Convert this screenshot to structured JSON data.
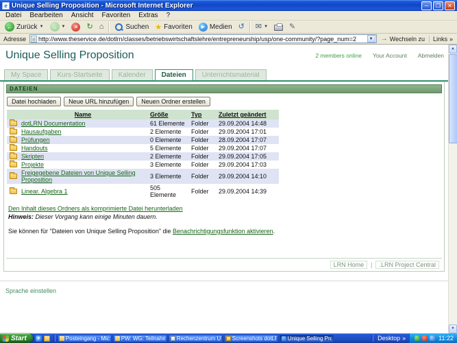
{
  "window": {
    "title": "Unique Selling Proposition - Microsoft Internet Explorer"
  },
  "menu": {
    "items": [
      "Datei",
      "Bearbeiten",
      "Ansicht",
      "Favoriten",
      "Extras",
      "?"
    ]
  },
  "toolbar": {
    "back": "Zurück",
    "search": "Suchen",
    "favorites": "Favoriten",
    "media": "Medien"
  },
  "address": {
    "label": "Adresse",
    "url": "http://www.theservice.de/dotlrn/classes/betriebswirtschaftslehre/entrepreneurship/usp/one-community/?page_num=2",
    "go": "Wechseln zu",
    "links": "Links",
    "chevron": "»"
  },
  "page": {
    "title": "Unique Selling Proposition",
    "members_online": "2 members online",
    "your_account": "Your Account",
    "logout": "Abmelden",
    "tabs": [
      {
        "label": "My Space"
      },
      {
        "label": "Kurs-Startseite"
      },
      {
        "label": "Kalender"
      },
      {
        "label": "Dateien"
      },
      {
        "label": "Unterrichtsmaterial"
      }
    ],
    "section_header": "DATEIEN",
    "buttons": [
      "Datei hochladen",
      "Neue URL hinzufügen",
      "Neuen Ordner erstellen"
    ],
    "table": {
      "headers": [
        "Name",
        "Größe",
        "Typ",
        "Zuletzt geändert"
      ],
      "rows": [
        {
          "name": "dotLRN Documentation",
          "size": "61 Elemente",
          "type": "Folder",
          "modified": "29.09.2004 14:48"
        },
        {
          "name": "Hausaufgaben",
          "size": "2 Elemente",
          "type": "Folder",
          "modified": "29.09.2004 17:01"
        },
        {
          "name": "Prüfungen",
          "size": "0 Elemente",
          "type": "Folder",
          "modified": "28.09.2004 17:07"
        },
        {
          "name": "Handouts",
          "size": "5 Elemente",
          "type": "Folder",
          "modified": "29.09.2004 17:07"
        },
        {
          "name": "Skripten",
          "size": "2 Elemente",
          "type": "Folder",
          "modified": "29.09.2004 17:05"
        },
        {
          "name": "Projekte",
          "size": "3 Elemente",
          "type": "Folder",
          "modified": "29.09.2004 17:03"
        },
        {
          "name": "Freigegebene Dateien von Unique Selling Proposition",
          "size": "3 Elemente",
          "type": "Folder",
          "modified": "29.09.2004 14:10"
        },
        {
          "name": "Linear. Algebra 1",
          "size": "505 Elemente",
          "type": "Folder",
          "modified": "29.09.2004 14:39"
        }
      ]
    },
    "download_link": "Den Inhalt dieses Ordners als komprimierte Datei herunterladen",
    "hint_label": "Hinweis:",
    "hint_text": " Dieser Vorgang kann einige Minuten dauern.",
    "notification_prefix": "Sie können für \"Dateien von Unique Selling Proposition\" die ",
    "notification_link": "Benachrichtigungsfunktion aktivieren",
    "notification_suffix": ".",
    "footer_links": [
      {
        "label": "LRN Home"
      },
      {
        "label": ".LRN Project Central"
      }
    ],
    "footer_separator": "|",
    "language_link": "Sprache einstellen"
  },
  "taskbar": {
    "start": "Start",
    "items": [
      {
        "label": "Posteingang - Micros..."
      },
      {
        "label": "PW: WG: Teilnahme v..."
      },
      {
        "label": "Rechenzentrum Uni K..."
      },
      {
        "label": "Screenshots dotLRN..."
      },
      {
        "label": "Unique Selling Proposi..."
      }
    ],
    "desktop_label": "Desktop",
    "chevron": "»",
    "time": "11:22"
  }
}
